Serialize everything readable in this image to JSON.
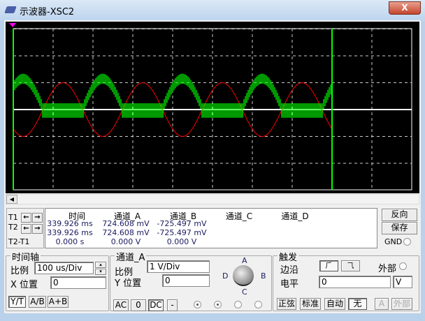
{
  "window": {
    "title": "示波器-XSC2",
    "close_label": "X"
  },
  "cursors": {
    "t1": "T1",
    "t2": "T2",
    "t2t1": "T2-T1",
    "left_arrow": "🡐",
    "right_arrow": "🡒"
  },
  "measurements": {
    "headers": [
      "时间",
      "通道_A",
      "通道_B",
      "通道_C",
      "通道_D"
    ],
    "rows": [
      [
        "339.926 ms",
        "724.608 mV",
        "-725.497 mV"
      ],
      [
        "339.926 ms",
        "724.608 mV",
        "-725.497 mV"
      ],
      [
        "0.000 s",
        "0.000 V",
        "0.000 V"
      ]
    ]
  },
  "side_buttons": {
    "reverse": "反向",
    "save": "保存",
    "gnd": "GND"
  },
  "timebase": {
    "title": "时间轴",
    "scale_label": "比例",
    "scale_value": "100 us/Div",
    "xpos_label": "X 位置",
    "xpos_value": "0",
    "modes": [
      "Y/T",
      "A/B",
      "A+B"
    ],
    "active_mode": "Y/T"
  },
  "channel_a": {
    "title": "通道_A",
    "scale_label": "比例",
    "scale_value": "1  V/Div",
    "ypos_label": "Y 位置",
    "ypos_value": "0",
    "coupling": [
      "AC",
      "0",
      "DC",
      "-"
    ],
    "active_coupling": "DC",
    "knob_labels": [
      "A",
      "B",
      "C",
      "D"
    ]
  },
  "trigger": {
    "title": "触发",
    "edge_label": "边沿",
    "edge_rise": "⺁",
    "edge_fall": "⺄",
    "external_label": "外部",
    "level_label": "电平",
    "level_value": "0",
    "level_unit": "V",
    "modes": [
      "正弦",
      "标准",
      "自动",
      "无"
    ],
    "active_mode": "无",
    "source_a": "A",
    "source_ext": "外部"
  },
  "waveforms": {
    "channel_a_color": "#00ff00",
    "channel_b_color": "#ff0000",
    "time_div_us": 100,
    "volts_div": 1,
    "frequency_khz": 5,
    "channel_b_amplitude_v": 1.0,
    "channel_a_peak_v": 1.1,
    "cursor2_division": 8
  }
}
